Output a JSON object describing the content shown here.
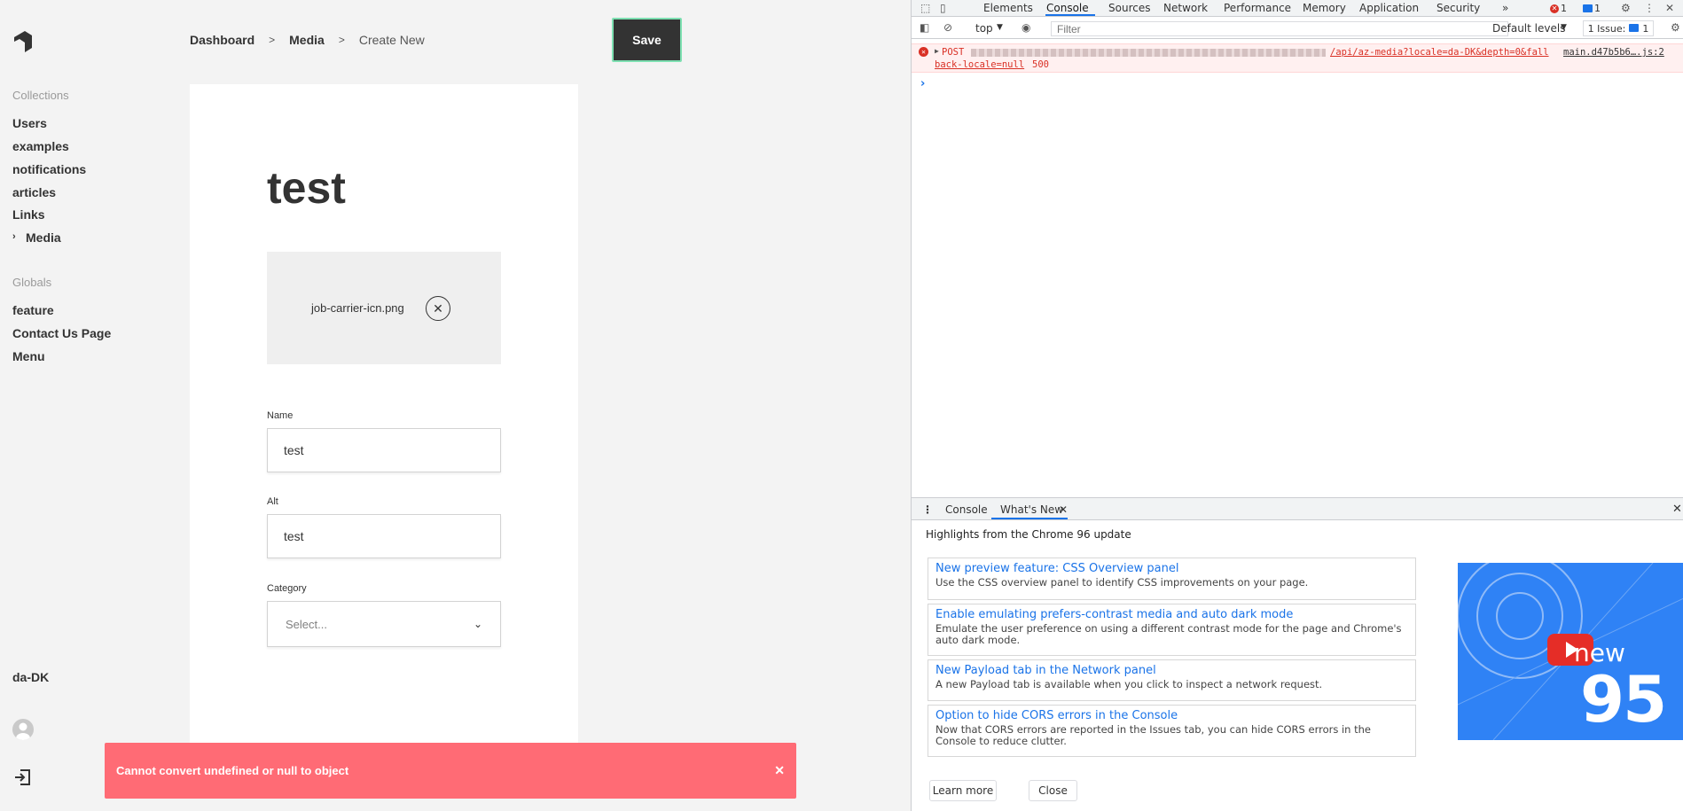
{
  "app": {
    "sidebar": {
      "collections_heading": "Collections",
      "collections": [
        "Users",
        "examples",
        "notifications",
        "articles",
        "Links"
      ],
      "active_collection": "Media",
      "globals_heading": "Globals",
      "globals": [
        "feature",
        "Contact Us Page",
        "Menu"
      ],
      "locale": "da-DK"
    },
    "breadcrumb": {
      "items": [
        "Dashboard",
        "Media"
      ],
      "current": "Create New",
      "separator": ">"
    },
    "save_label": "Save",
    "form": {
      "title": "test",
      "file_name": "job-carrier-icn.png",
      "name_label": "Name",
      "name_value": "test",
      "alt_label": "Alt",
      "alt_value": "test",
      "category_label": "Category",
      "category_placeholder": "Select..."
    },
    "toast": {
      "message": "Cannot convert undefined or null to object",
      "close": "✕"
    }
  },
  "devtools": {
    "tabs": [
      "Elements",
      "Console",
      "Sources",
      "Network",
      "Performance",
      "Memory",
      "Application",
      "Security"
    ],
    "active_tab": "Console",
    "overflow": "»",
    "error_count": "1",
    "message_count": "1",
    "toolbar": {
      "context": "top",
      "filter_placeholder": "Filter",
      "levels": "Default levels",
      "issues_label": "1 Issue:",
      "issues_count": "1"
    },
    "console_error": {
      "method": "POST",
      "url": "/api/az-media?locale=da-DK&depth=0&fall",
      "url_cont": "back-locale=null",
      "status": "500",
      "source": "main.d47b5b6….js:2"
    },
    "drawer": {
      "tabs": [
        "Console",
        "What's New"
      ],
      "active_tab": "What's New",
      "headline": "Highlights from the Chrome 96 update",
      "cards": [
        {
          "title": "New preview feature: CSS Overview panel",
          "desc": "Use the CSS overview panel to identify CSS improvements on your page."
        },
        {
          "title": "Enable emulating prefers-contrast media and auto dark mode",
          "desc": "Emulate the user preference on using a different contrast mode for the page and Chrome's auto dark mode."
        },
        {
          "title": "New Payload tab in the Network panel",
          "desc": "A new Payload tab is available when you click to inspect a network request."
        },
        {
          "title": "Option to hide CORS errors in the Console",
          "desc": "Now that CORS errors are reported in the Issues tab, you can hide CORS errors in the Console to reduce clutter."
        }
      ],
      "thumb_new": "new",
      "thumb_number": "95",
      "learn_more": "Learn more",
      "close": "Close"
    }
  },
  "colors": {
    "save_border": "#7ee0b2",
    "toast_bg": "#ff6b75",
    "devtools_accent": "#1a73e8",
    "error_red": "#d93025"
  }
}
